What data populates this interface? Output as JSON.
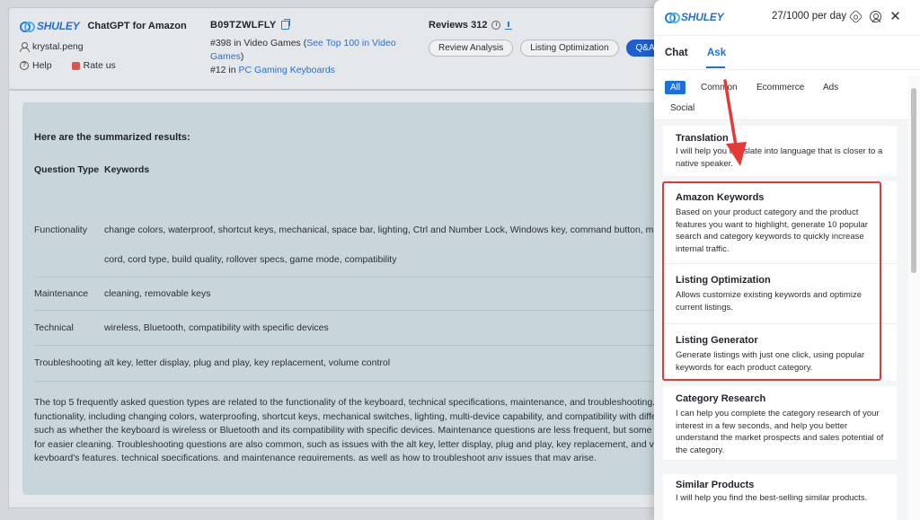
{
  "background": {
    "brand": {
      "logo_text": "SHULEY",
      "app_name": "ChatGPT for Amazon"
    },
    "user": {
      "name": "krystal.peng"
    },
    "help_label": "Help",
    "rate_label": "Rate us",
    "asin": "B09TZWLFLY",
    "rank_1_prefix": "#398 in Video Games (",
    "rank_1_link": "See Top 100 in Video Games",
    "rank_1_suffix": ")",
    "rank_2_prefix": "#12 in ",
    "rank_2_link": "PC Gaming Keyboards",
    "reviews_title": "Reviews 312",
    "pills": [
      {
        "label": "Review Analysis",
        "active": false
      },
      {
        "label": "Listing Optimization",
        "active": false
      },
      {
        "label": "Q&A A",
        "active": true
      }
    ],
    "result": {
      "heading": "Here are the summarized results:",
      "col_type": "Question Type",
      "col_keywords": "Keywords",
      "rows": [
        {
          "type": "Functionality",
          "keywords": "change colors, waterproof, shortcut keys, mechanical, space bar, lighting, Ctrl and Number Lock, Windows key, command button, multi",
          "keywords_2": "cord, cord type, build quality, rollover specs, game mode, compatibility"
        },
        {
          "type": "Maintenance",
          "keywords": "cleaning, removable keys"
        },
        {
          "type": "Technical",
          "keywords": "wireless, Bluetooth, compatibility with specific devices"
        },
        {
          "type": "Troubleshooting",
          "keywords": "alt key, letter display, plug and play, key replacement, volume control"
        }
      ],
      "summary": "The top 5 frequently asked question types are related to the functionality of the keyboard, technical specifications, maintenance, and troubleshooting. The functionality, including changing colors, waterproofing, shortcut keys, mechanical switches, lighting, multi-device capability, and compatibility with differ such as whether the keyboard is wireless or Bluetooth and its compatibility with specific devices. Maintenance questions are less frequent, but some use for easier cleaning. Troubleshooting questions are also common, such as issues with the alt key, letter display, plug and play, key replacement, and volum keyboard's features, technical specifications, and maintenance requirements, as well as how to troubleshoot any issues that may arise."
    }
  },
  "panel": {
    "logo_text": "SHULEY",
    "usage": "27/1000 per day",
    "tabs": [
      {
        "label": "Chat",
        "active": false
      },
      {
        "label": "Ask",
        "active": true
      }
    ],
    "filters": [
      {
        "label": "All",
        "active": true
      },
      {
        "label": "Common",
        "active": false
      },
      {
        "label": "Ecommerce",
        "active": false
      },
      {
        "label": "Ads",
        "active": false
      },
      {
        "label": "Social",
        "active": false
      }
    ],
    "cards": [
      {
        "title": "Translation",
        "desc": "I will help you translate into language that is closer to a native speaker."
      },
      {
        "title": "Amazon Keywords",
        "desc": "Based on your product category and the product features you want to highlight, generate 10 popular search and category keywords to quickly increase internal traffic."
      },
      {
        "title": "Listing Optimization",
        "desc": "Allows customize existing keywords and optimize current listings."
      },
      {
        "title": "Listing Generator",
        "desc": "Generate listings with just one click, using popular keywords for each product category."
      },
      {
        "title": "Category Research",
        "desc": "I can help you complete the category research of your interest in a few seconds, and help you better understand the market prospects and sales potential of the category."
      },
      {
        "title": "Similar Products",
        "desc": "I will help you find the best-selling similar products."
      }
    ]
  },
  "annotation_color": "#e53935",
  "accent_color": "#1d6fe0"
}
